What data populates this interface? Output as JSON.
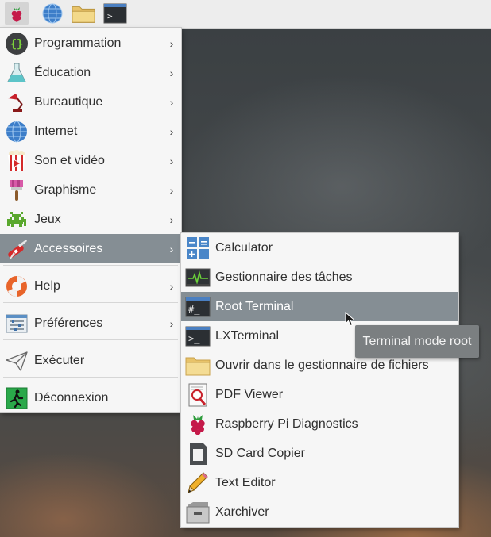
{
  "panel": {
    "buttons": [
      {
        "name": "raspberry-menu-icon"
      },
      {
        "name": "web-browser-icon"
      },
      {
        "name": "file-manager-icon"
      },
      {
        "name": "terminal-icon"
      }
    ]
  },
  "main_menu": {
    "items": [
      {
        "label": "Programmation",
        "icon": "braces-icon",
        "submenu": true
      },
      {
        "label": "Éducation",
        "icon": "flask-icon",
        "submenu": true
      },
      {
        "label": "Bureautique",
        "icon": "desk-lamp-icon",
        "submenu": true
      },
      {
        "label": "Internet",
        "icon": "globe-icon",
        "submenu": true
      },
      {
        "label": "Son et vidéo",
        "icon": "popcorn-video-icon",
        "submenu": true
      },
      {
        "label": "Graphisme",
        "icon": "paintbrush-icon",
        "submenu": true
      },
      {
        "label": "Jeux",
        "icon": "space-invader-icon",
        "submenu": true
      },
      {
        "label": "Accessoires",
        "icon": "swiss-knife-icon",
        "submenu": true,
        "highlighted": true
      },
      {
        "label": "Help",
        "icon": "lifebuoy-icon",
        "submenu": true
      },
      {
        "label": "Préférences",
        "icon": "preferences-icon",
        "submenu": true
      },
      {
        "label": "Exécuter",
        "icon": "paper-plane-icon",
        "submenu": false
      },
      {
        "label": "Déconnexion",
        "icon": "exit-runner-icon",
        "submenu": false
      }
    ]
  },
  "sub_menu": {
    "items": [
      {
        "label": "Calculator",
        "icon": "calculator-icon"
      },
      {
        "label": "Gestionnaire des tâches",
        "icon": "task-manager-icon"
      },
      {
        "label": "Root Terminal",
        "icon": "root-terminal-icon",
        "highlighted": true
      },
      {
        "label": "LXTerminal",
        "icon": "terminal-icon"
      },
      {
        "label": "Ouvrir dans le gestionnaire de fichiers",
        "icon": "folder-icon"
      },
      {
        "label": "PDF Viewer",
        "icon": "pdf-viewer-icon"
      },
      {
        "label": "Raspberry Pi Diagnostics",
        "icon": "raspberry-icon"
      },
      {
        "label": "SD Card Copier",
        "icon": "sd-card-icon"
      },
      {
        "label": "Text Editor",
        "icon": "pencil-icon"
      },
      {
        "label": "Xarchiver",
        "icon": "archive-icon"
      }
    ]
  },
  "tooltip": {
    "text": "Terminal mode root"
  },
  "colors": {
    "highlight": "#858e94",
    "menu_bg": "#f6f6f6",
    "panel_bg": "#ededed",
    "tooltip_bg": "#7b7f81"
  }
}
